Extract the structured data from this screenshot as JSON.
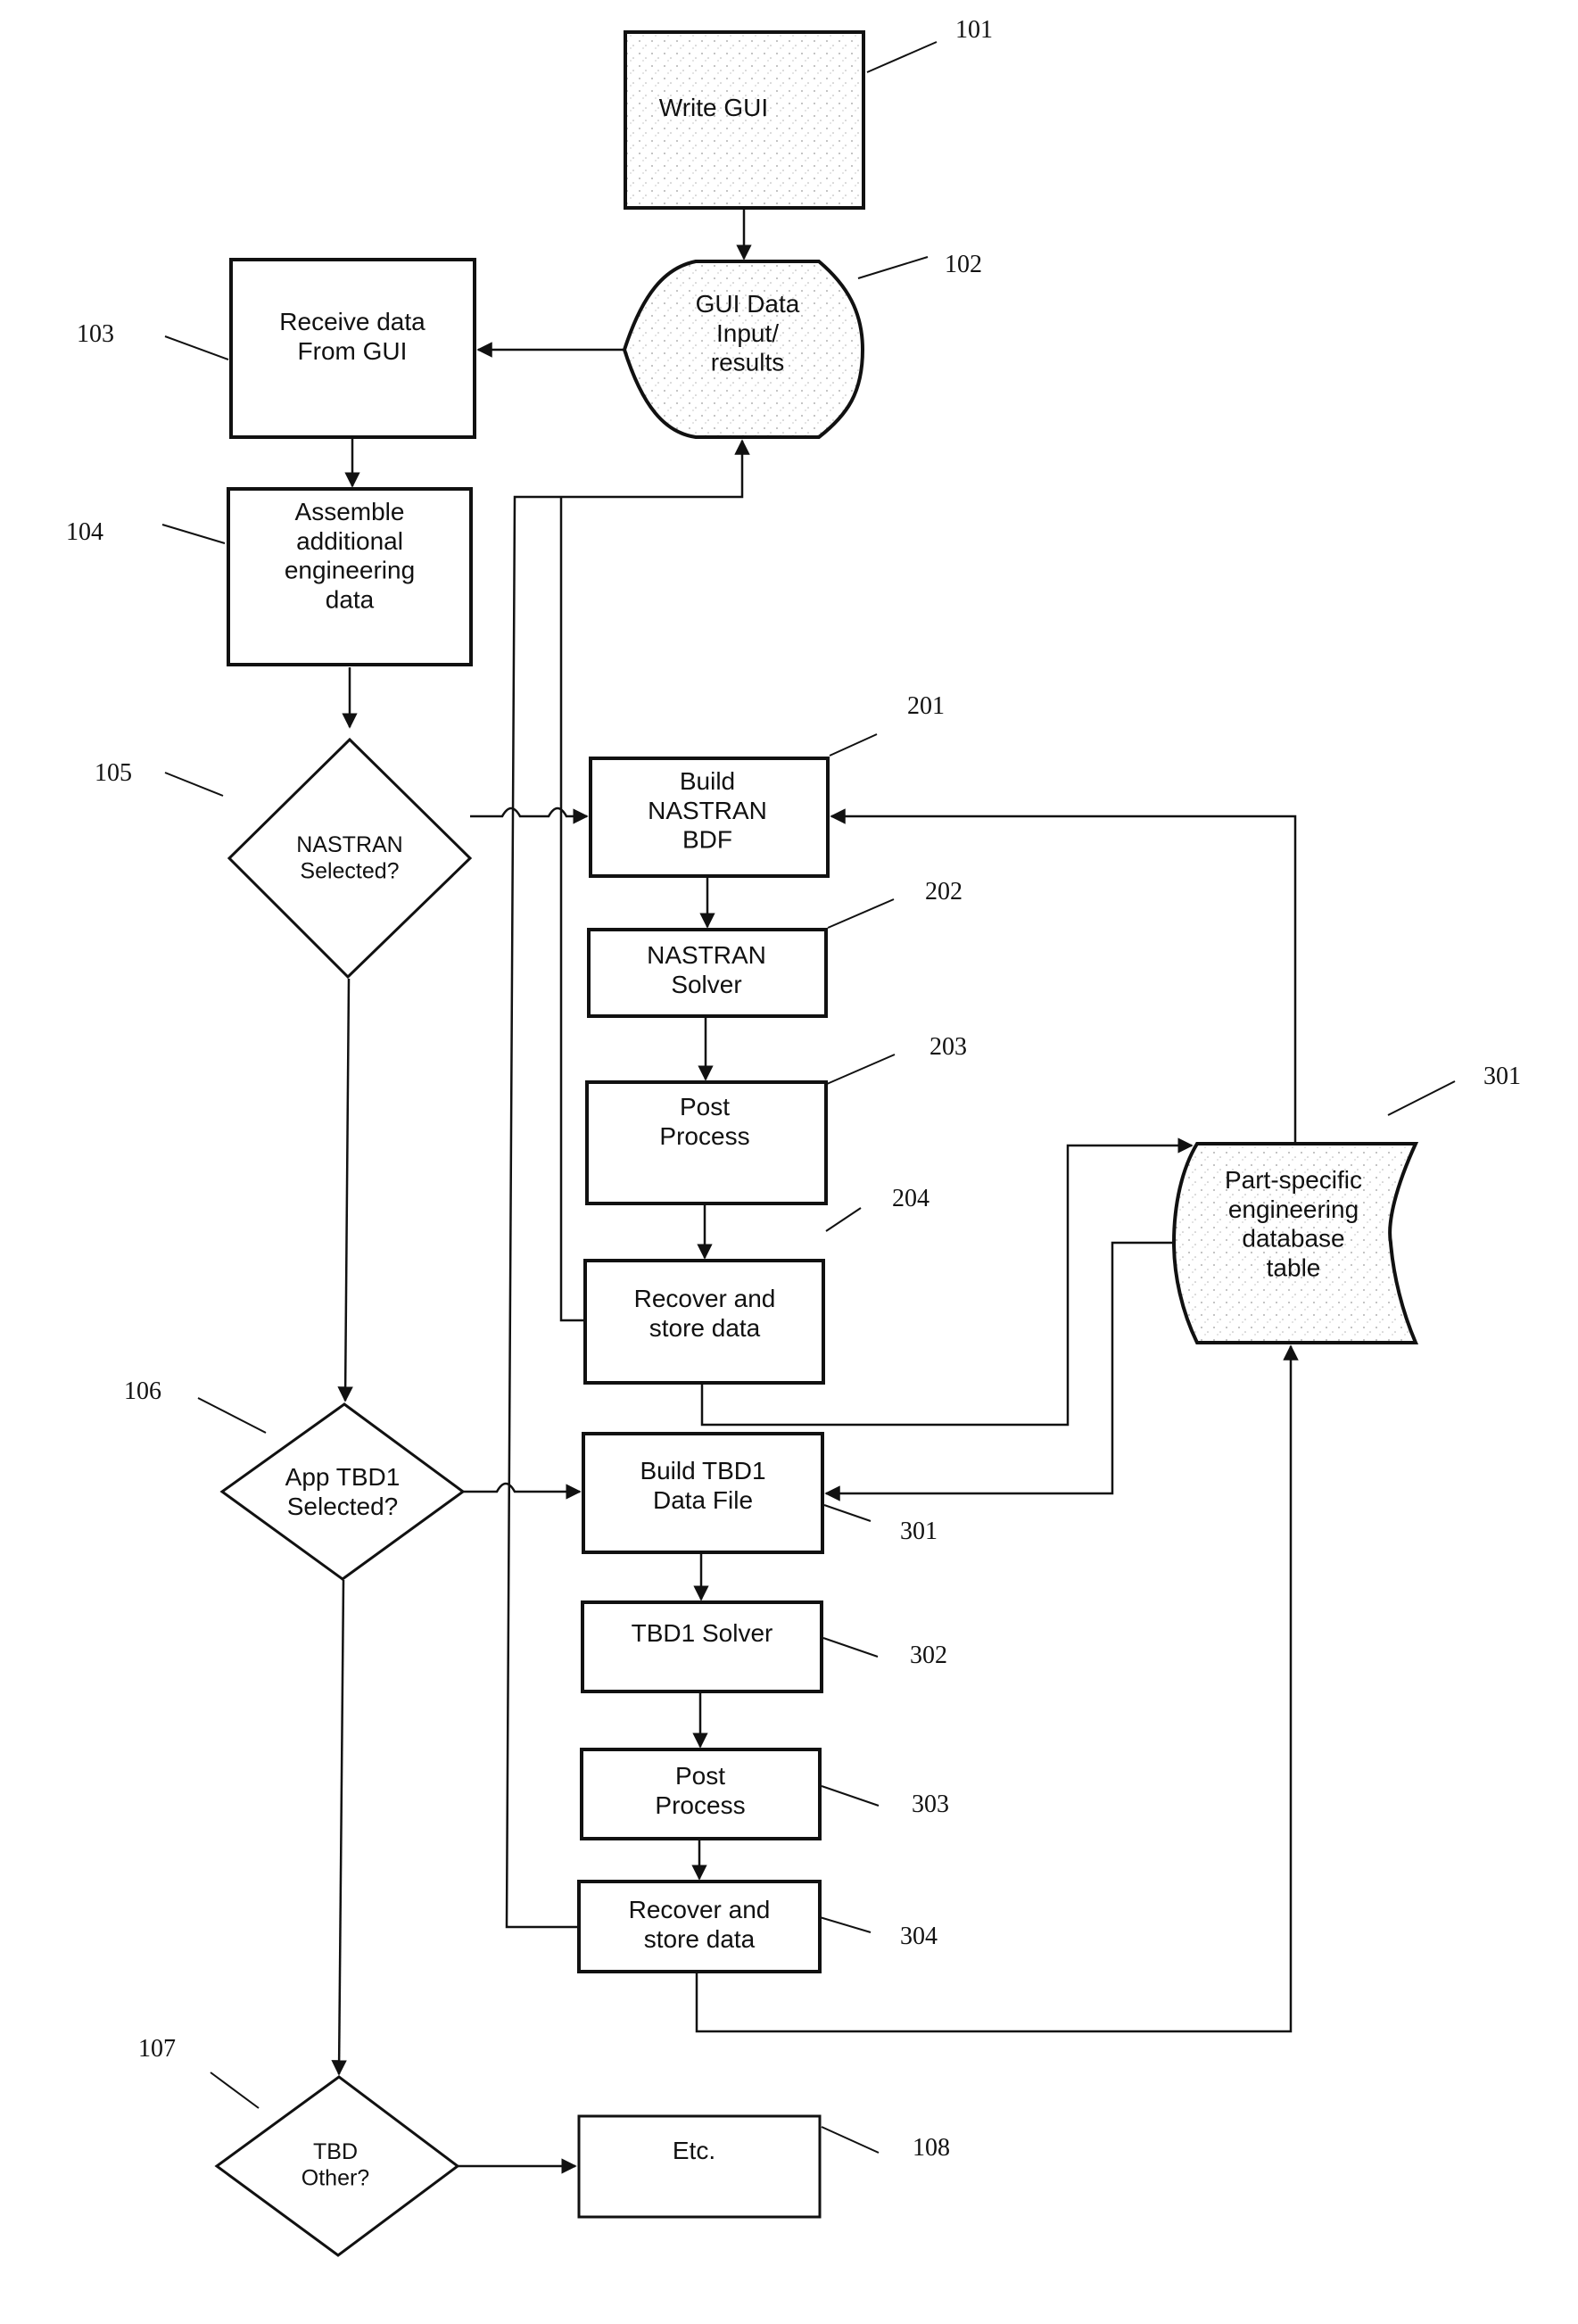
{
  "figure": {
    "nodes": {
      "write_gui": {
        "ref": "101",
        "lines": [
          "Write GUI"
        ]
      },
      "gui_data": {
        "ref": "102",
        "lines": [
          "GUI Data",
          "Input/",
          "results"
        ]
      },
      "receive_data": {
        "ref": "103",
        "lines": [
          "Receive data",
          "From GUI"
        ]
      },
      "assemble": {
        "ref": "104",
        "lines": [
          "Assemble",
          "additional",
          "engineering",
          "data"
        ]
      },
      "nastran_selected": {
        "ref": "105",
        "lines": [
          "NASTRAN",
          "Selected?"
        ]
      },
      "tbd1_selected": {
        "ref": "106",
        "lines": [
          "App TBD1",
          "Selected?"
        ]
      },
      "tbd_other": {
        "ref": "107",
        "lines": [
          "TBD",
          "Other?"
        ]
      },
      "etc": {
        "ref": "108",
        "lines": [
          "Etc."
        ]
      },
      "build_nastran": {
        "ref": "201",
        "lines": [
          "Build",
          "NASTRAN",
          "BDF"
        ]
      },
      "nastran_solver": {
        "ref": "202",
        "lines": [
          "NASTRAN",
          "Solver"
        ]
      },
      "nastran_post": {
        "ref": "203",
        "lines": [
          "Post",
          "Process"
        ]
      },
      "nastran_recover": {
        "ref": "204",
        "lines": [
          "Recover and",
          "store data"
        ]
      },
      "database": {
        "ref": "301",
        "lines": [
          "Part-specific",
          "engineering",
          "database",
          "table"
        ]
      },
      "build_tbd1": {
        "ref": "301",
        "lines": [
          "Build TBD1",
          "Data File"
        ]
      },
      "tbd1_solver": {
        "ref": "302",
        "lines": [
          "TBD1 Solver"
        ]
      },
      "tbd1_post": {
        "ref": "303",
        "lines": [
          "Post",
          "Process"
        ]
      },
      "tbd1_recover": {
        "ref": "304",
        "lines": [
          "Recover and",
          "store data"
        ]
      }
    }
  }
}
